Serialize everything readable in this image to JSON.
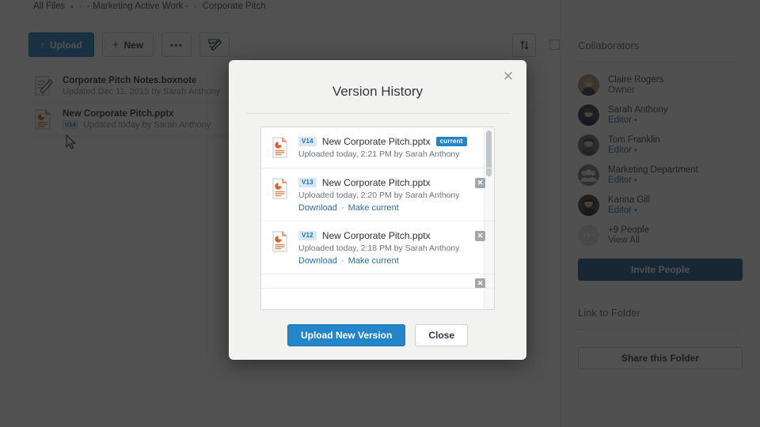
{
  "breadcrumb": {
    "items": [
      "All Files",
      "- Marketing Active Work -",
      "Corporate Pitch"
    ],
    "separator": "›",
    "caret": "▾"
  },
  "toolbar": {
    "upload_label": "Upload",
    "upload_icon": "arrow-up-icon",
    "new_label": "New",
    "new_icon": "plus-icon",
    "more_label": "•••",
    "boxnote_icon": "boxnote-pen-icon",
    "sort_icon": "sort-arrows-icon",
    "select_all_checkbox": ""
  },
  "files": [
    {
      "name": "Corporate Pitch Notes.boxnote",
      "sub": "Updated Dec 11, 2015 by Sarah Anthony",
      "icon": "boxnote-icon",
      "version": ""
    },
    {
      "name": "New Corporate Pitch.pptx",
      "sub": "Updated today by Sarah Anthony",
      "icon": "powerpoint-icon",
      "version": "V14"
    }
  ],
  "sidebar": {
    "collaborators_title": "Collaborators",
    "collaborators": [
      {
        "name": "Claire Rogers",
        "role": "Owner",
        "role_is_link": false,
        "avatar_color": "#9b8176"
      },
      {
        "name": "Sarah Anthony",
        "role": "Editor",
        "role_is_link": true,
        "avatar_color": "#2f3e57"
      },
      {
        "name": "Tom Franklin",
        "role": "Editor",
        "role_is_link": true,
        "avatar_color": "#6d6f6b"
      },
      {
        "name": "Marketing Department",
        "role": "Editor",
        "role_is_link": true,
        "avatar_color": "#7c8084"
      },
      {
        "name": "Karina Gill",
        "role": "Editor",
        "role_is_link": true,
        "avatar_color": "#4a4038"
      },
      {
        "name": "+9 People",
        "role": "View All",
        "role_is_link": true,
        "avatar_color": "#c8cbce"
      }
    ],
    "invite_label": "Invite People",
    "link_to_folder_title": "Link to Folder",
    "share_label": "Share this Folder"
  },
  "modal": {
    "title": "Version History",
    "close_icon": "close-icon",
    "versions": [
      {
        "badge": "V14",
        "name": "New Corporate Pitch.pptx",
        "current_label": "current",
        "sub": "Uploaded today, 2:21 PM by Sarah Anthony",
        "download_label": "",
        "make_current_label": "",
        "separator": "",
        "deletable": false
      },
      {
        "badge": "V13",
        "name": "New Corporate Pitch.pptx",
        "current_label": "",
        "sub": "Uploaded today, 2:20 PM by Sarah Anthony",
        "download_label": "Download",
        "make_current_label": "Make current",
        "separator": "·",
        "deletable": true
      },
      {
        "badge": "V12",
        "name": "New Corporate Pitch.pptx",
        "current_label": "",
        "sub": "Uploaded today, 2:18 PM by Sarah Anthony",
        "download_label": "Download",
        "make_current_label": "Make current",
        "separator": "·",
        "deletable": true
      }
    ],
    "upload_new_version_label": "Upload New Version",
    "close_label": "Close"
  },
  "colors": {
    "accent_blue": "#2485c9",
    "invite_blue": "#1f5f8f",
    "link_blue": "#2d6ca3",
    "badge_bg": "#d6e7f6",
    "ppt_orange": "#d8622c",
    "overlay": "rgba(20,20,20,0.74)"
  }
}
